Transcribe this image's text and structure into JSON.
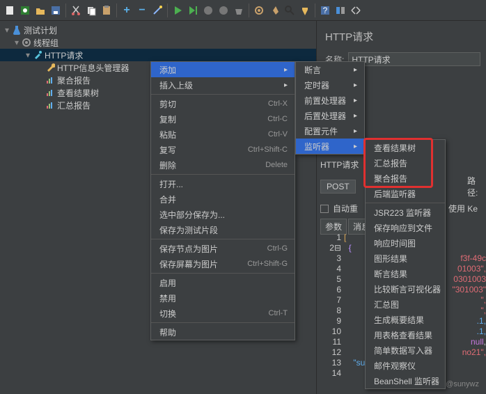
{
  "toolbar_icons": [
    "new",
    "template",
    "open",
    "save",
    "cut",
    "copy",
    "paste",
    "plus",
    "minus",
    "wand",
    "run",
    "run-next",
    "stop",
    "stop-all",
    "clear",
    "gear",
    "broom",
    "find",
    "clear2",
    "help",
    "toggle",
    "expand"
  ],
  "tree": {
    "root": "测试计划",
    "threadgroup": "线程组",
    "http": "HTTP请求",
    "children": [
      "HTTP信息头管理器",
      "聚合报告",
      "查看结果树",
      "汇总报告"
    ]
  },
  "right": {
    "title": "HTTP请求",
    "name_label": "名称:",
    "name_value": "HTTP请求"
  },
  "menu1": {
    "add": "添加",
    "insert_parent": "插入上级",
    "cut": "剪切",
    "cut_sc": "Ctrl-X",
    "copy": "复制",
    "copy_sc": "Ctrl-C",
    "paste": "粘贴",
    "paste_sc": "Ctrl-V",
    "duplicate": "复写",
    "dup_sc": "Ctrl+Shift-C",
    "delete": "删除",
    "del_sc": "Delete",
    "open": "打开...",
    "merge": "合并",
    "save_sel": "选中部分保存为...",
    "save_frag": "保存为测试片段",
    "save_node_img": "保存节点为图片",
    "sni_sc": "Ctrl-G",
    "save_screen_img": "保存屏幕为图片",
    "ssi_sc": "Ctrl+Shift-G",
    "enable": "启用",
    "disable": "禁用",
    "toggle": "切换",
    "tog_sc": "Ctrl-T",
    "help": "帮助"
  },
  "menu2": [
    "断言",
    "定时器",
    "前置处理器",
    "后置处理器",
    "配置元件",
    "监听器"
  ],
  "menu3": [
    "查看结果树",
    "汇总报告",
    "聚合报告",
    "后端监听器",
    "JSR223 监听器",
    "保存响应到文件",
    "响应时间图",
    "图形结果",
    "断言结果",
    "比较断言可视化器",
    "汇总图",
    "生成概要结果",
    "用表格查看结果",
    "简单数据写入器",
    "邮件观察仪",
    "BeanShell 监听器"
  ],
  "panel": {
    "http_req_label": "HTTP请求",
    "method": "POST",
    "path_label": "路径:",
    "auto": "自动重",
    "keepalive": "使用 Ke",
    "tab_params": "参数",
    "tab_body": "消息"
  },
  "code": {
    "ln": [
      "1",
      "2",
      "3",
      "4",
      "5",
      "6",
      "7",
      "8",
      "9",
      "10",
      "11",
      "12",
      "13",
      "14"
    ],
    "l1": "[",
    "l2": "{",
    "frag3": "f3f-49c",
    "frag4": "01003\",",
    "frag5": "0301003",
    "frag6": "\"301003\"",
    "frag7": "\",",
    "frag8": "\",",
    "frag9": ".1,",
    "frag10": ".1,",
    "frag_null": "null",
    "frag11": "no21\",",
    "frag12": "\"supplierReco"
  },
  "watermark": "CSDN @sunywz"
}
